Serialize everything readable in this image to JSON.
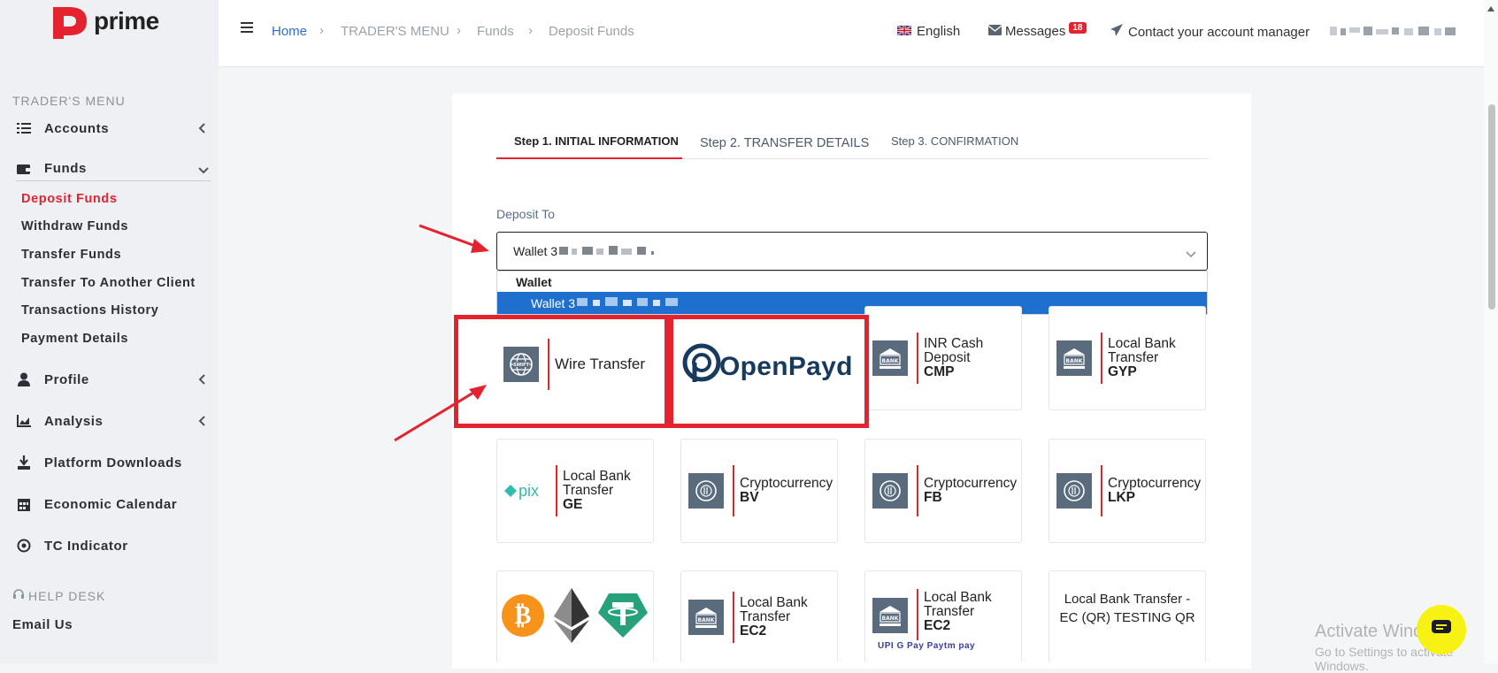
{
  "brand": {
    "name": "prime"
  },
  "sidebar": {
    "section_title": "TRADER'S MENU",
    "items": [
      {
        "label": "Accounts",
        "icon": "list-icon"
      },
      {
        "label": "Funds",
        "icon": "wallet-icon"
      },
      {
        "label": "Profile",
        "icon": "user-icon"
      },
      {
        "label": "Analysis",
        "icon": "chart-icon"
      },
      {
        "label": "Platform Downloads",
        "icon": "download-icon"
      },
      {
        "label": "Economic Calendar",
        "icon": "calendar-icon"
      },
      {
        "label": "TC Indicator",
        "icon": "target-icon"
      }
    ],
    "funds_sub": [
      "Deposit Funds",
      "Withdraw Funds",
      "Transfer Funds",
      "Transfer To Another Client",
      "Transactions History",
      "Payment Details"
    ],
    "help_title": "HELP DESK",
    "help_items": [
      "Email Us"
    ]
  },
  "topbar": {
    "breadcrumb": [
      "Home",
      "TRADER'S MENU",
      "Funds",
      "Deposit Funds"
    ],
    "language": "English",
    "messages_label": "Messages",
    "messages_count": "18",
    "contact_label": "Contact your account manager"
  },
  "steps": [
    "Step 1. INITIAL INFORMATION",
    "Step 2. TRANSFER DETAILS",
    "Step 3. CONFIRMATION"
  ],
  "deposit": {
    "label": "Deposit To",
    "selected": "Wallet 3",
    "dropdown_group": "Wallet",
    "dropdown_option": "Wallet 3"
  },
  "methods": [
    {
      "title": "Wire Transfer",
      "code": "",
      "icon": "swift-icon"
    },
    {
      "title": "OpenPayd",
      "code": "",
      "icon": "openpayd-logo"
    },
    {
      "title": "INR Cash Deposit",
      "code": "CMP",
      "icon": "bank-icon"
    },
    {
      "title": "Local Bank Transfer",
      "code": "GYP",
      "icon": "bank-icon"
    },
    {
      "title": "Local Bank Transfer",
      "code": "GE",
      "icon": "pix-logo"
    },
    {
      "title": "Cryptocurrency",
      "code": "BV",
      "icon": "crypto-icon"
    },
    {
      "title": "Cryptocurrency",
      "code": "FB",
      "icon": "crypto-icon"
    },
    {
      "title": "Cryptocurrency",
      "code": "LKP",
      "icon": "crypto-icon"
    },
    {
      "title": "",
      "code": "",
      "icon": "crypto-coins-logos"
    },
    {
      "title": "Local Bank Transfer",
      "code": "EC2",
      "icon": "bank-icon"
    },
    {
      "title": "Local Bank Transfer",
      "code": "EC2",
      "icon": "bank-icon"
    },
    {
      "title": "Local Bank Transfer - EC (QR) TESTING QR",
      "code": "",
      "icon": ""
    }
  ],
  "pix_text": "pix",
  "bank_icon_text": "BANK",
  "swift_icon_text": "SWIFT",
  "upi_strip": "UPI G Pay Paytm pay",
  "windows_notice": {
    "line1": "Activate Windows",
    "line2": "Go to Settings to activate Windows."
  },
  "colors": {
    "accent": "#e4232f",
    "link": "#2a6fd6",
    "selected": "#1f6fcf",
    "badge": "#e4232f",
    "chat": "#f7f213"
  }
}
